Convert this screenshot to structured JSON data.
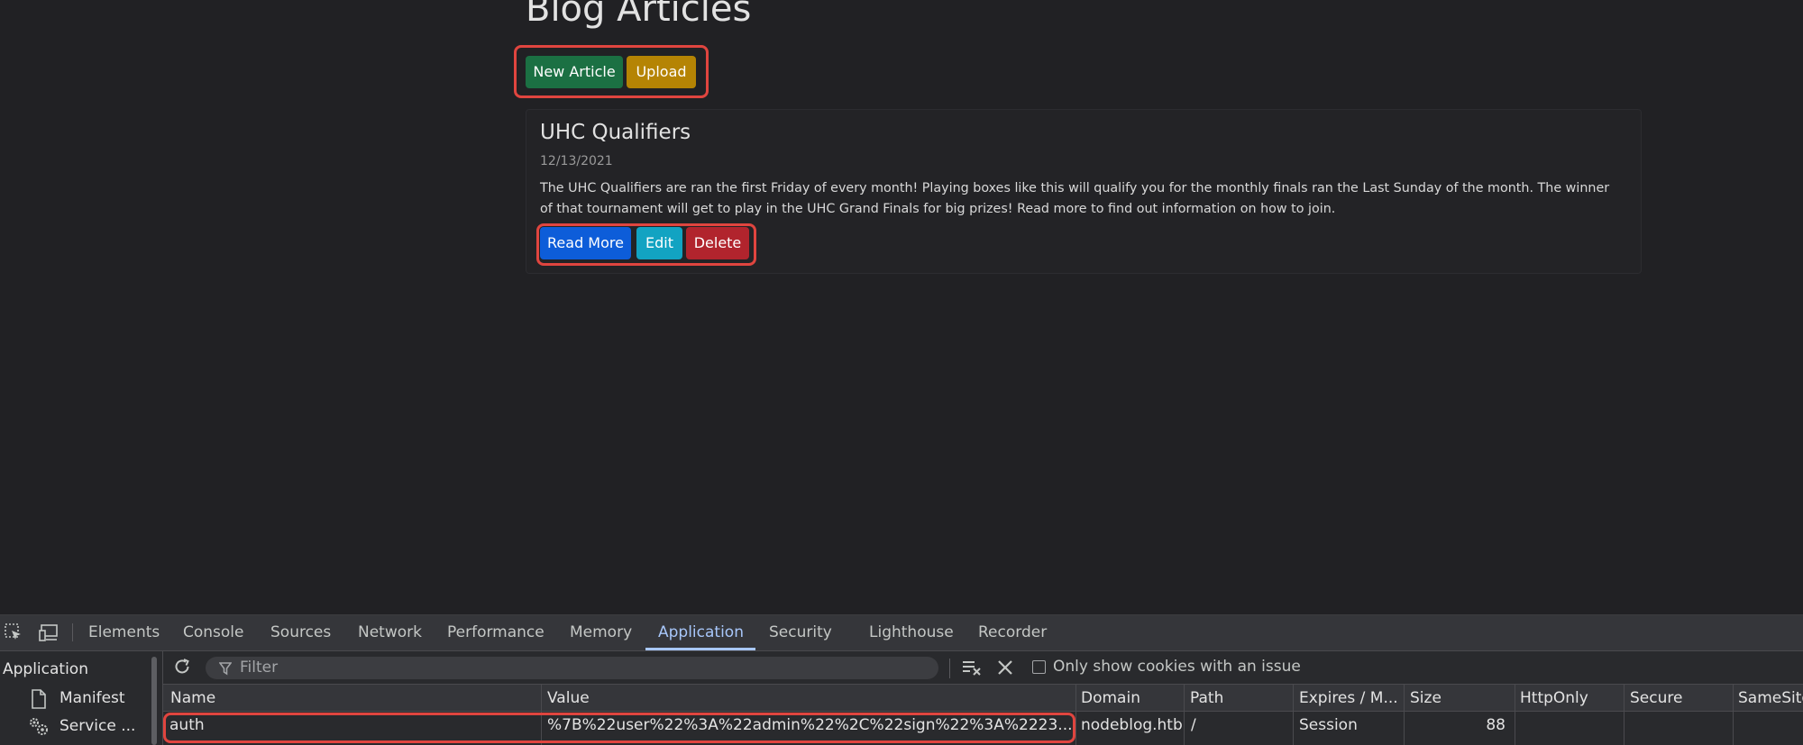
{
  "page": {
    "title": "Blog Articles",
    "buttons": {
      "new_article": "New Article",
      "upload": "Upload"
    },
    "article": {
      "title": "UHC Qualifiers",
      "date": "12/13/2021",
      "text": "The UHC Qualifiers are ran the first Friday of every month! Playing boxes like this will qualify you for the monthly finals ran the Last Sunday of the month. The winner of that tournament will get to play in the UHC Grand Finals for big prizes! Read more to find out information on how to join.",
      "buttons": {
        "read_more": "Read More",
        "edit": "Edit",
        "delete": "Delete"
      }
    },
    "colors": {
      "highlight": "#e0453f",
      "green": "#1b7043",
      "yellow": "#b58404",
      "blue": "#0d5dd9",
      "cyan": "#12a3c2",
      "red": "#b1242d"
    }
  },
  "devtools": {
    "icons": [
      "inspect-element-icon",
      "device-toolbar-icon"
    ],
    "tabs": [
      "Elements",
      "Console",
      "Sources",
      "Network",
      "Performance",
      "Memory",
      "Application",
      "Security",
      "Lighthouse",
      "Recorder"
    ],
    "active_tab": "Application",
    "sidebar": {
      "heading": "Application",
      "items": [
        {
          "label": "Manifest",
          "icon": "file-icon"
        },
        {
          "label": "Service ...",
          "icon": "gears-icon"
        }
      ]
    },
    "toolbar": {
      "filter_placeholder": "Filter",
      "only_issues_label": "Only show cookies with an issue"
    },
    "cookies": {
      "columns": [
        "Name",
        "Value",
        "Domain",
        "Path",
        "Expires / M...",
        "Size",
        "HttpOnly",
        "Secure",
        "SameSite"
      ],
      "rows": [
        {
          "name": "auth",
          "value": "%7B%22user%22%3A%22admin%22%2C%22sign%22%3A%2223...",
          "domain": "nodeblog.htb",
          "path": "/",
          "expires": "Session",
          "size": "88",
          "httponly": "",
          "secure": "",
          "samesite": ""
        }
      ]
    }
  }
}
